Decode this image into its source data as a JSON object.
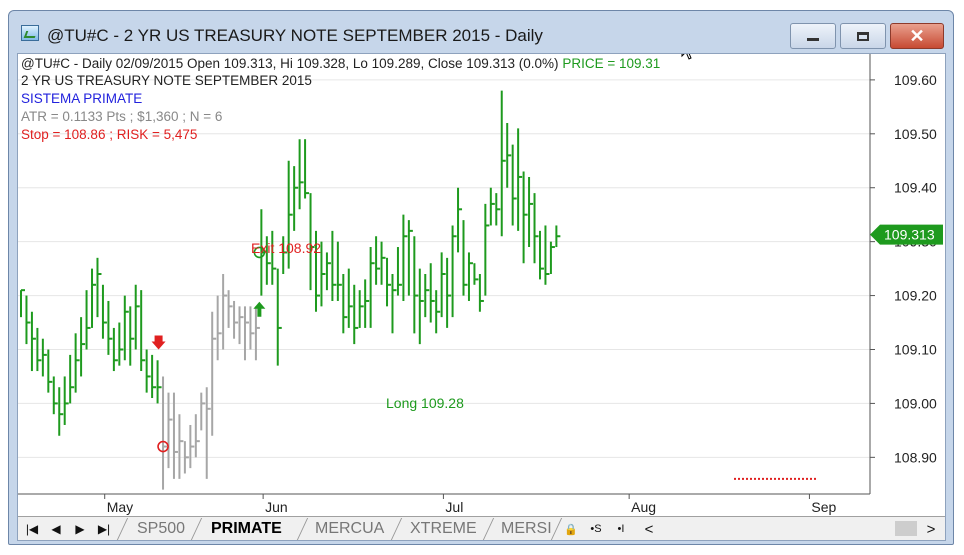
{
  "window": {
    "title": "@TU#C - 2 YR US TREASURY NOTE SEPTEMBER 2015 - Daily",
    "close_glyph": "✕"
  },
  "info": {
    "line1_prefix": "@TU#C - Daily 02/09/2015 Open 109.313, Hi 109.328, Lo 109.289, Close 109.313 (0.0%)",
    "line1_price": "PRICE = 109.31",
    "line2": "2 YR US TREASURY NOTE SEPTEMBER 2015",
    "line3": "SISTEMA PRIMATE",
    "line4": "ATR = 0.1133 Pts ; $1,360 ; N = 6",
    "line5": "Stop = 108.86 ; RISK = 5,475"
  },
  "annotations": {
    "exit": "Exit 108.92",
    "long": "Long 109.28"
  },
  "colors": {
    "green": "#1e9a1e",
    "gray": "#a6a6a6",
    "red": "#e02020",
    "blue": "#2222dd",
    "window_frame": "#c6d6ea"
  },
  "chart_data": {
    "type": "ohlc",
    "y_ticks": [
      "109.60",
      "109.50",
      "109.40",
      "109.30",
      "109.20",
      "109.10",
      "109.00",
      "108.90"
    ],
    "x_ticks": [
      "May",
      "Jun",
      "Jul",
      "Aug",
      "Sep"
    ],
    "ylim": [
      108.832,
      109.648
    ],
    "current_price": "109.313",
    "stop_level": 108.86,
    "grid": true,
    "segments": [
      {
        "color": "green",
        "bars": [
          [
            109.21,
            109.16,
            109.21
          ],
          [
            109.2,
            109.11,
            109.15
          ],
          [
            109.17,
            109.06,
            109.12
          ],
          [
            109.14,
            109.06,
            109.08
          ],
          [
            109.12,
            109.05,
            109.09
          ],
          [
            109.1,
            109.02,
            109.04
          ],
          [
            109.05,
            108.98,
            109.0
          ],
          [
            109.03,
            108.94,
            108.98
          ],
          [
            109.05,
            108.96,
            109.0
          ],
          [
            109.09,
            109.0,
            109.03
          ],
          [
            109.13,
            109.02,
            109.08
          ],
          [
            109.16,
            109.05,
            109.11
          ],
          [
            109.21,
            109.1,
            109.14
          ],
          [
            109.25,
            109.14,
            109.22
          ],
          [
            109.27,
            109.16,
            109.24
          ],
          [
            109.22,
            109.12,
            109.15
          ],
          [
            109.19,
            109.09,
            109.12
          ],
          [
            109.14,
            109.06,
            109.08
          ],
          [
            109.15,
            109.07,
            109.1
          ],
          [
            109.2,
            109.08,
            109.17
          ],
          [
            109.18,
            109.07,
            109.12
          ],
          [
            109.22,
            109.1,
            109.18
          ],
          [
            109.21,
            109.06,
            109.08
          ],
          [
            109.1,
            109.02,
            109.05
          ],
          [
            109.09,
            109.01,
            109.03
          ],
          [
            109.08,
            109.0,
            109.03
          ]
        ]
      },
      {
        "color": "gray",
        "bars": [
          [
            109.05,
            108.84,
            108.92
          ],
          [
            109.02,
            108.88,
            108.97
          ],
          [
            109.02,
            108.86,
            108.91
          ],
          [
            108.98,
            108.86,
            108.93
          ],
          [
            108.93,
            108.87,
            108.9
          ],
          [
            108.96,
            108.88,
            108.92
          ],
          [
            108.98,
            108.9,
            108.93
          ],
          [
            109.02,
            108.95,
            109.0
          ],
          [
            109.03,
            108.86,
            108.99
          ],
          [
            109.17,
            108.94,
            109.12
          ],
          [
            109.2,
            109.08,
            109.13
          ],
          [
            109.24,
            109.1,
            109.2
          ],
          [
            109.21,
            109.14,
            109.18
          ],
          [
            109.19,
            109.12,
            109.15
          ],
          [
            109.18,
            109.11,
            109.16
          ],
          [
            109.18,
            109.08,
            109.15
          ],
          [
            109.18,
            109.1,
            109.13
          ],
          [
            109.18,
            109.08,
            109.14
          ]
        ]
      },
      {
        "color": "green",
        "bars": [
          [
            109.36,
            109.2,
            109.28
          ],
          [
            109.31,
            109.22,
            109.26
          ],
          [
            109.32,
            109.22,
            109.25
          ],
          [
            109.25,
            109.07,
            109.14
          ],
          [
            109.31,
            109.24,
            109.28
          ],
          [
            109.45,
            109.25,
            109.35
          ],
          [
            109.44,
            109.32,
            109.4
          ],
          [
            109.49,
            109.36,
            109.41
          ],
          [
            109.49,
            109.38,
            109.39
          ],
          [
            109.39,
            109.21,
            109.29
          ],
          [
            109.32,
            109.17,
            109.2
          ],
          [
            109.3,
            109.18,
            109.24
          ],
          [
            109.28,
            109.21,
            109.26
          ],
          [
            109.32,
            109.19,
            109.22
          ],
          [
            109.3,
            109.19,
            109.22
          ],
          [
            109.24,
            109.13,
            109.16
          ],
          [
            109.25,
            109.14,
            109.18
          ],
          [
            109.22,
            109.11,
            109.14
          ],
          [
            109.21,
            109.14,
            109.18
          ],
          [
            109.23,
            109.14,
            109.19
          ],
          [
            109.29,
            109.14,
            109.26
          ],
          [
            109.31,
            109.22,
            109.25
          ],
          [
            109.3,
            109.22,
            109.27
          ],
          [
            109.27,
            109.18,
            109.22
          ],
          [
            109.24,
            109.13,
            109.21
          ],
          [
            109.29,
            109.2,
            109.22
          ],
          [
            109.35,
            109.19,
            109.31
          ],
          [
            109.34,
            109.2,
            109.32
          ],
          [
            109.31,
            109.13,
            109.2
          ],
          [
            109.25,
            109.11,
            109.19
          ],
          [
            109.24,
            109.16,
            109.21
          ],
          [
            109.26,
            109.15,
            109.19
          ],
          [
            109.21,
            109.13,
            109.17
          ],
          [
            109.28,
            109.16,
            109.24
          ],
          [
            109.27,
            109.14,
            109.2
          ],
          [
            109.33,
            109.16,
            109.31
          ],
          [
            109.4,
            109.28,
            109.36
          ],
          [
            109.34,
            109.2,
            109.22
          ],
          [
            109.28,
            109.19,
            109.26
          ],
          [
            109.26,
            109.22,
            109.23
          ],
          [
            109.24,
            109.17,
            109.19
          ],
          [
            109.37,
            109.2,
            109.33
          ],
          [
            109.4,
            109.33,
            109.37
          ],
          [
            109.39,
            109.33,
            109.36
          ],
          [
            109.58,
            109.31,
            109.45
          ],
          [
            109.52,
            109.4,
            109.46
          ],
          [
            109.48,
            109.33,
            109.38
          ],
          [
            109.51,
            109.32,
            109.42
          ],
          [
            109.43,
            109.26,
            109.35
          ],
          [
            109.42,
            109.29,
            109.37
          ],
          [
            109.39,
            109.26,
            109.31
          ],
          [
            109.32,
            109.23,
            109.25
          ],
          [
            109.33,
            109.22,
            109.24
          ],
          [
            109.3,
            109.24,
            109.29
          ],
          [
            109.33,
            109.29,
            109.31
          ]
        ]
      }
    ],
    "markers": {
      "exit_circle_value": 108.92,
      "entry_circle_value": 109.28,
      "down_arrow_value": 109.1,
      "up_arrow_value": 109.17
    }
  },
  "tabs": [
    {
      "label": "SP500"
    },
    {
      "label": "PRIMATE"
    },
    {
      "label": "MERCUA"
    },
    {
      "label": "XTREME"
    },
    {
      "label": "MERSI"
    }
  ],
  "nav": {
    "first": "|◀",
    "prev": "◀",
    "next": "▶",
    "last": "▶|",
    "lock": "🔒",
    "btn_s": "•S",
    "btn_i": "•I",
    "scroll_left": "<",
    "scroll_right": ">"
  }
}
